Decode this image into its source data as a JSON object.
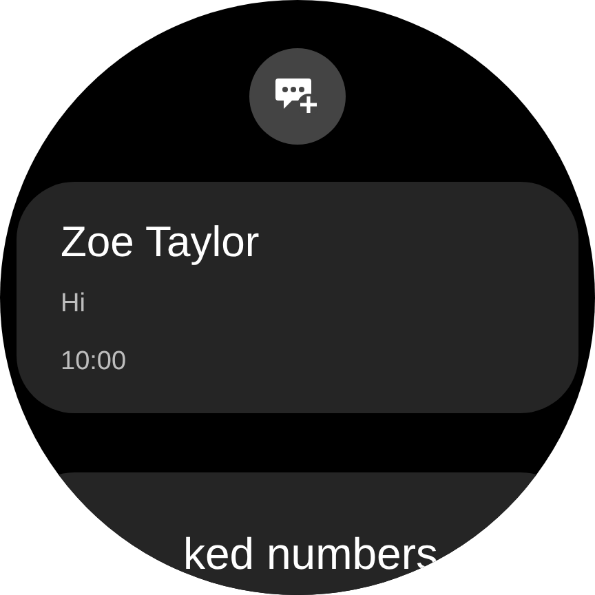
{
  "conversations": [
    {
      "name": "Zoe Taylor",
      "preview": "Hi",
      "time": "10:00"
    }
  ],
  "next_item": {
    "label": "ked numbers"
  }
}
